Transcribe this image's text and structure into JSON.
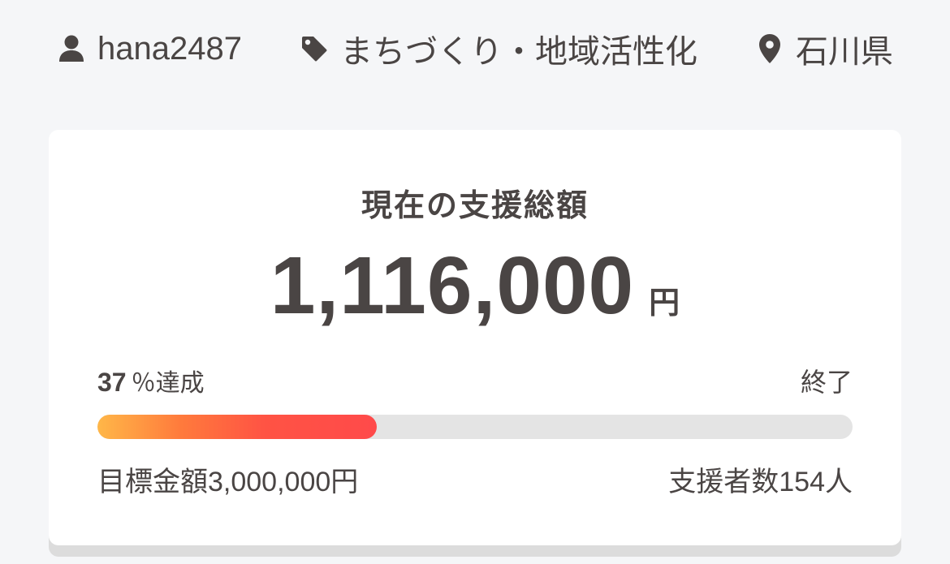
{
  "meta": {
    "user": {
      "name": "hana2487",
      "icon": "user-icon"
    },
    "category": {
      "label": "まちづくり・地域活性化",
      "icon": "tag-icon"
    },
    "location": {
      "label": "石川県",
      "icon": "map-pin-icon"
    }
  },
  "funding": {
    "title": "現在の支援総額",
    "amount": "1,116,000",
    "currency": "円",
    "achievement_percent": "37",
    "achievement_suffix": "％達成",
    "progress": 0.37,
    "status": "終了",
    "goal_label": "目標金額3,000,000円",
    "supporters_label": "支援者数154人"
  },
  "colors": {
    "background": "#f5f6f8",
    "text": "#4a4544",
    "progress_start": "#ffb748",
    "progress_end": "#ff4a4a",
    "track": "#e4e4e4"
  }
}
